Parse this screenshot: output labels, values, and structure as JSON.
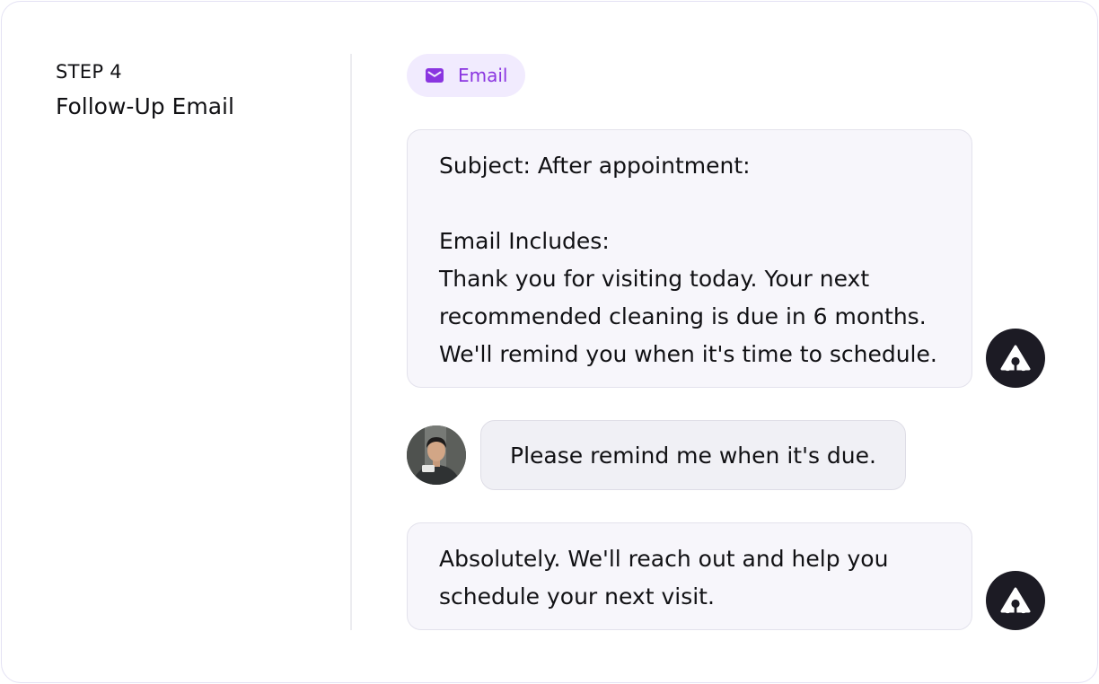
{
  "step": {
    "label": "STEP 4",
    "title": "Follow-Up Email"
  },
  "channel": {
    "icon": "mail-icon",
    "label": "Email",
    "accent_color": "#8a35e0",
    "pill_color": "#f1ebfe"
  },
  "messages": [
    {
      "sender": "assistant",
      "avatar_icon": "assistant-logo-icon",
      "lines": [
        "Subject: After appointment:",
        "",
        "Email Includes:",
        "Thank you for visiting today. Your next",
        "recommended cleaning is due in 6 months.",
        "We'll remind you when it's time to schedule."
      ]
    },
    {
      "sender": "user",
      "avatar": "user-photo",
      "text": "Please remind me when it's due."
    },
    {
      "sender": "assistant",
      "avatar_icon": "assistant-logo-icon",
      "lines": [
        "Absolutely. We'll reach out and help you",
        "schedule your next visit."
      ]
    }
  ]
}
